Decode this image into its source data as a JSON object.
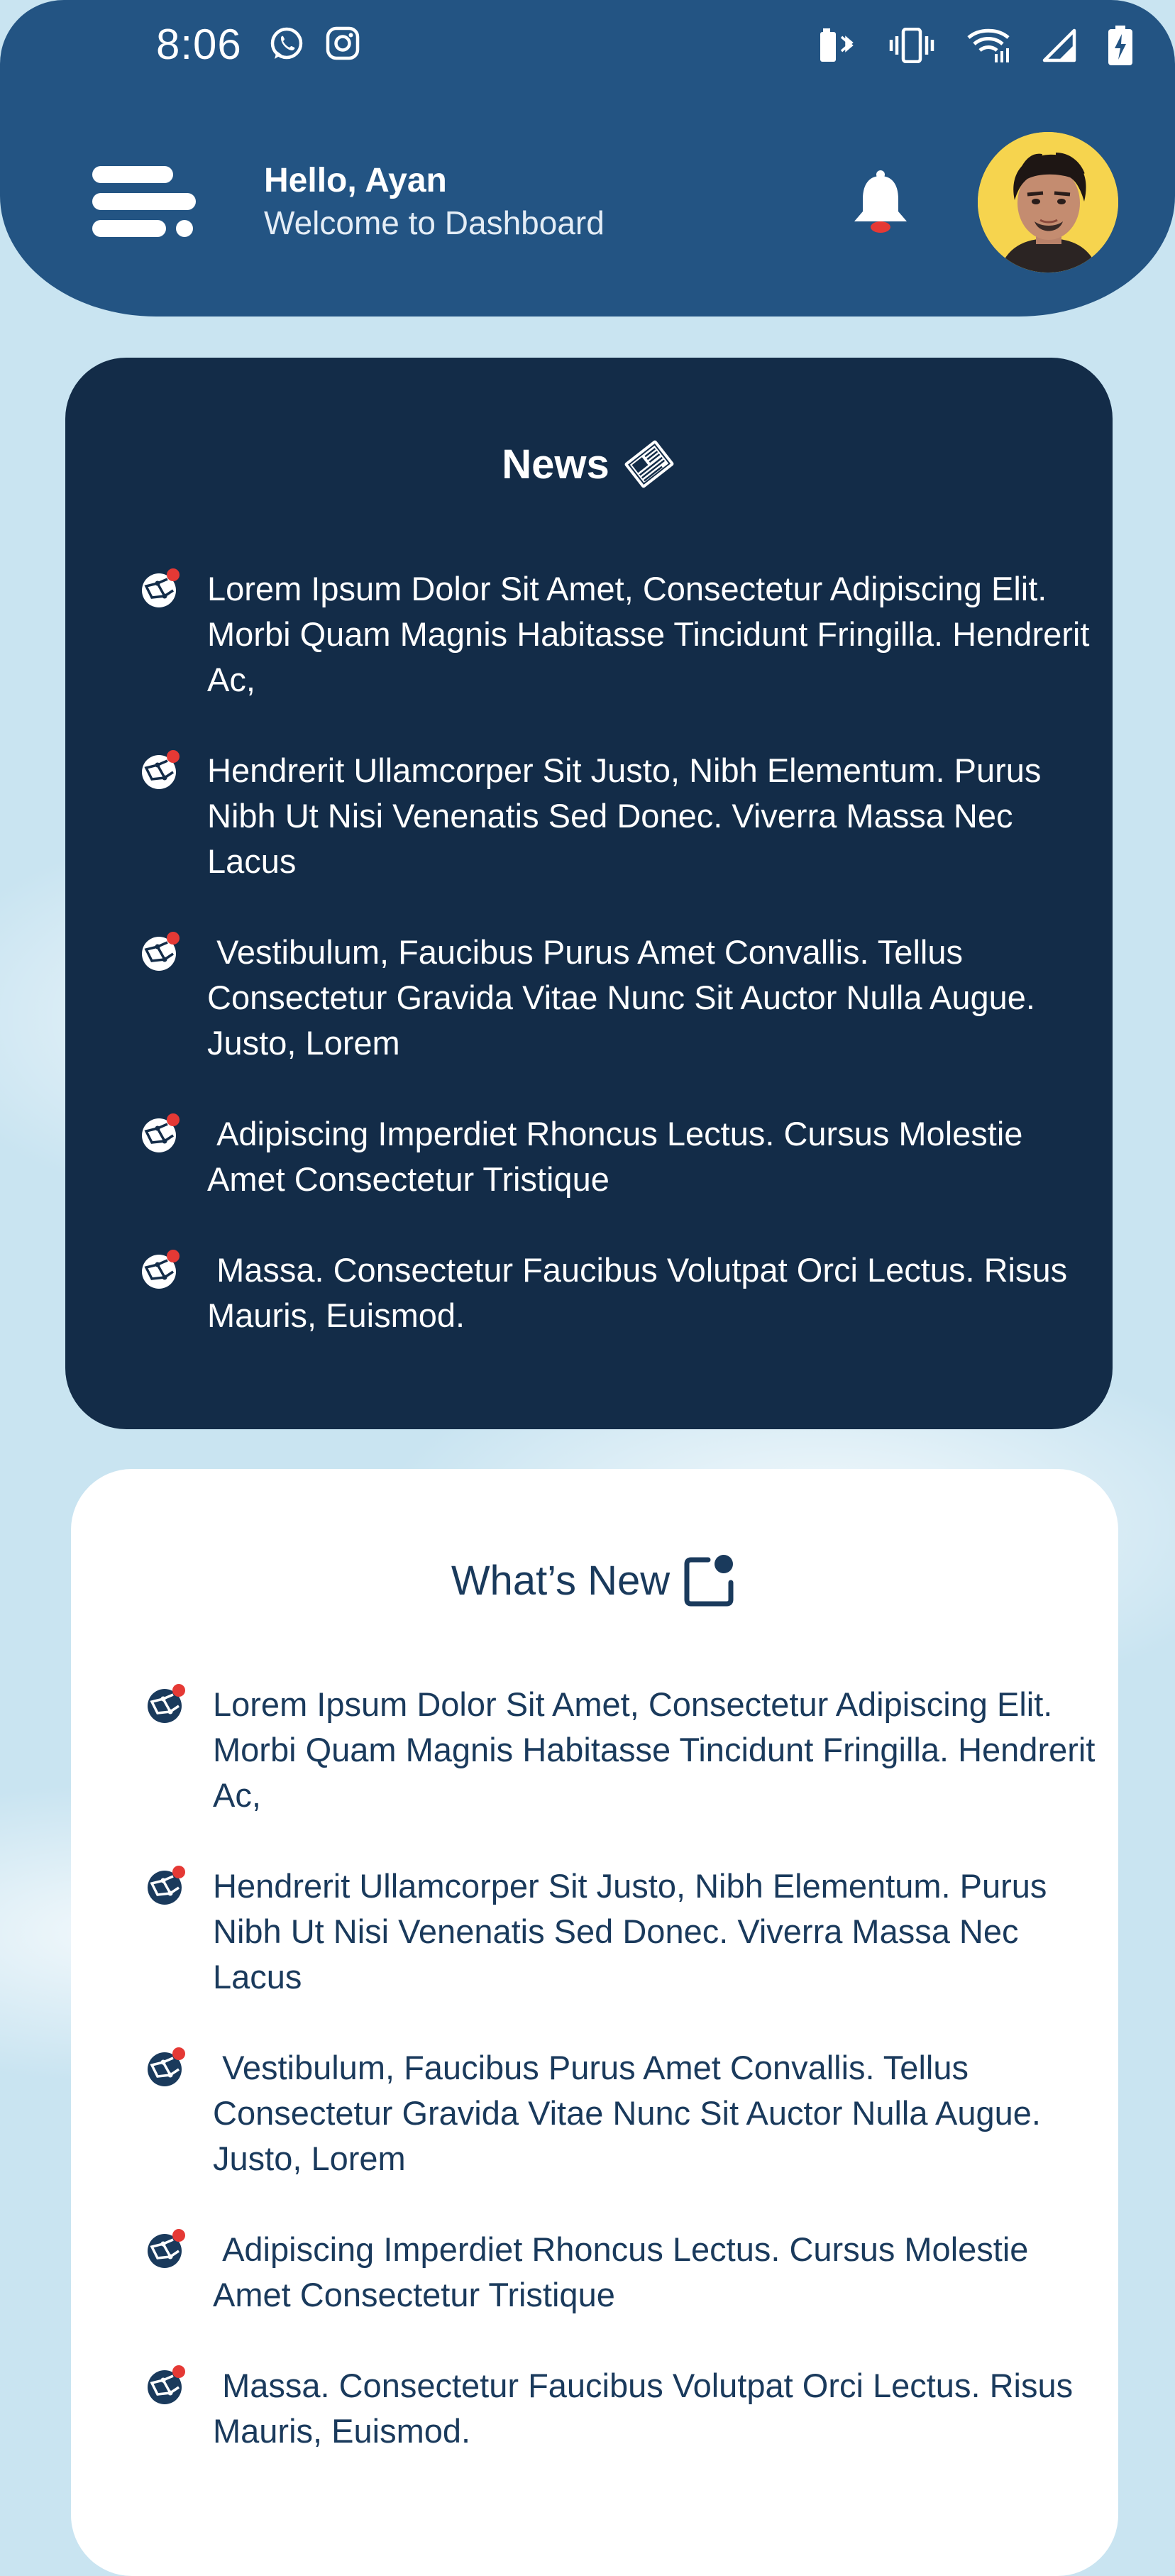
{
  "status_bar": {
    "time": "8:06",
    "left_icons": [
      "whatsapp-icon",
      "instagram-icon"
    ],
    "right_icons": [
      "battery-bluetooth-icon",
      "vibrate-icon",
      "wifi-icon",
      "signal-icon",
      "battery-charging-icon"
    ]
  },
  "header": {
    "greeting": "Hello, Ayan",
    "subtitle": "Welcome to Dashboard",
    "background_color": "#235483",
    "notification_dot_color": "#e53935"
  },
  "news": {
    "title": "News",
    "title_icon": "newspaper-icon",
    "background_color": "#132c48",
    "items": [
      {
        "text": "Lorem Ipsum Dolor Sit Amet, Consectetur Adipiscing Elit. Morbi Quam Magnis Habitasse Tincidunt Fringilla. Hendrerit Ac,"
      },
      {
        "text": "Hendrerit Ullamcorper Sit Justo, Nibh Elementum. Purus Nibh Ut Nisi Venenatis Sed Donec. Viverra Massa Nec Lacus"
      },
      {
        "text": " Vestibulum, Faucibus Purus Amet Convallis. Tellus Consectetur Gravida Vitae Nunc Sit Auctor Nulla Augue. Justo, Lorem"
      },
      {
        "text": " Adipiscing Imperdiet Rhoncus Lectus. Cursus Molestie Amet Consectetur Tristique"
      },
      {
        "text": " Massa. Consectetur Faucibus Volutpat Orci Lectus. Risus Mauris, Euismod."
      }
    ]
  },
  "whats_new": {
    "title": "What’s New",
    "title_icon": "notification-square-icon",
    "background_color": "#ffffff",
    "items": [
      {
        "text": "Lorem Ipsum Dolor Sit Amet, Consectetur Adipiscing Elit. Morbi Quam Magnis Habitasse Tincidunt Fringilla. Hendrerit Ac,"
      },
      {
        "text": "Hendrerit Ullamcorper Sit Justo, Nibh Elementum. Purus Nibh Ut Nisi Venenatis Sed Donec. Viverra Massa Nec Lacus"
      },
      {
        "text": " Vestibulum, Faucibus Purus Amet Convallis. Tellus Consectetur Gravida Vitae Nunc Sit Auctor Nulla Augue. Justo, Lorem"
      },
      {
        "text": " Adipiscing Imperdiet Rhoncus Lectus. Cursus Molestie Amet Consectetur Tristique"
      },
      {
        "text": " Massa. Consectetur Faucibus Volutpat Orci Lectus. Risus Mauris, Euismod."
      }
    ]
  }
}
